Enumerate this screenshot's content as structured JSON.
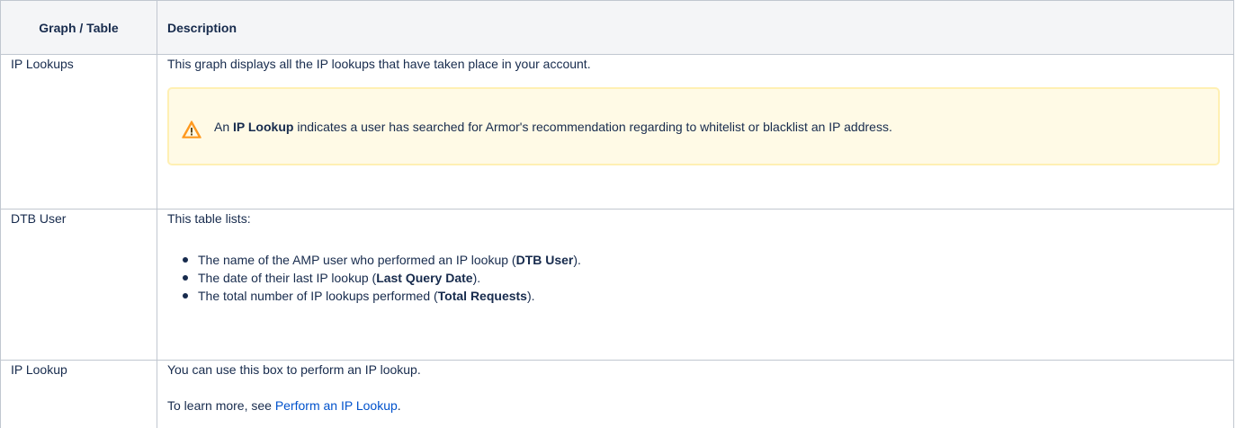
{
  "table": {
    "headers": [
      "Graph / Table",
      "Description"
    ],
    "rows": [
      {
        "name": "IP Lookups",
        "description": "This graph displays all the IP lookups that have taken place in your account.",
        "warning": {
          "icon": "warning-icon",
          "prefix": "An ",
          "bold": "IP Lookup",
          "suffix": " indicates a user has searched for Armor's recommendation regarding to whitelist or blacklist an IP address."
        }
      },
      {
        "name": "DTB User",
        "description": "This table lists:",
        "bullets": [
          {
            "prefix": "The name of the AMP user who performed an IP lookup (",
            "bold": "DTB User",
            "suffix": ")."
          },
          {
            "prefix": "The date of their last IP lookup (",
            "bold": "Last Query Date",
            "suffix": ")."
          },
          {
            "prefix": "The total number of IP lookups performed (",
            "bold": "Total Requests",
            "suffix": ")."
          }
        ]
      },
      {
        "name": "IP Lookup",
        "description": "You can use this box to perform an IP lookup.",
        "learn_more_prefix": "To learn more, see ",
        "link_text": "Perform an IP Lookup",
        "learn_more_suffix": "."
      }
    ]
  },
  "colors": {
    "header_bg": "#f4f5f7",
    "border": "#c1c7d0",
    "text": "#172b4d",
    "link": "#0052cc",
    "warning_bg": "#fffae6",
    "warning_border": "#fff0b3",
    "warning_icon": "#ff991f"
  }
}
